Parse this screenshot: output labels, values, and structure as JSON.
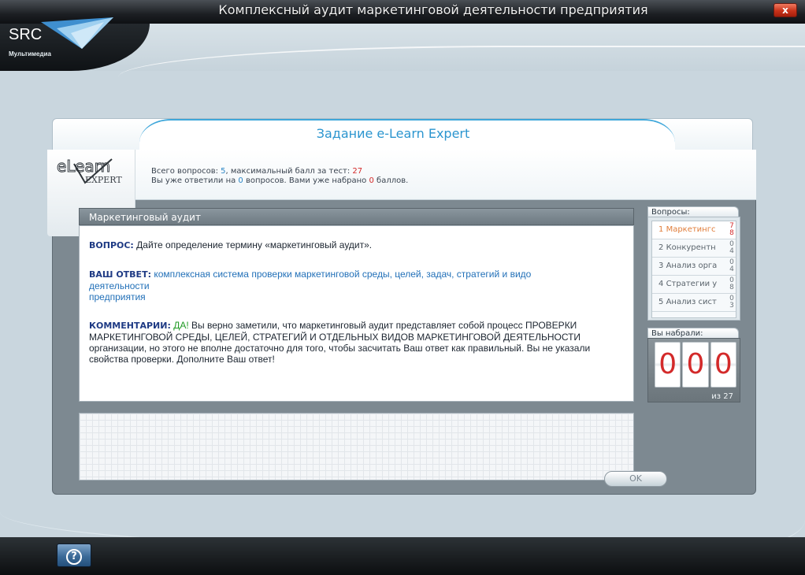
{
  "window": {
    "title": "Комплексный аудит маркетинговой деятельности предприятия",
    "close_label": "x"
  },
  "brand": {
    "name": "SRC",
    "subtitle": "Мультимедиа"
  },
  "task": {
    "title": "Задание e-Learn Expert",
    "badge_logo": "eLearn Expert"
  },
  "stats": {
    "line1_prefix": "Всего вопросов: ",
    "total_questions": "5",
    "line1_mid": ", максимальный балл за тест: ",
    "max_score": "27",
    "line2_prefix": "Вы уже ответили на ",
    "answered": "0",
    "line2_mid": " вопросов. Вами уже набрано ",
    "earned": "0",
    "line2_suffix": " баллов."
  },
  "section": {
    "title": "Маркетинговый аудит"
  },
  "question": {
    "label": "ВОПРОС:",
    "text": " Дайте определение термину «маркетинговый аудит»."
  },
  "answer": {
    "label": "ВАШ ОТВЕТ:",
    "text_line1": " комплексная система проверки маркетинговой среды, целей, задач, стратегий и видо",
    "text_line2": "деятельности",
    "text_line3": " предприятия"
  },
  "comment": {
    "label": "КОММЕНТАРИИ:",
    "yes": " ДА!",
    "text": " Вы верно заметили, что маркетинговый аудит представляет собой процесс ПРОВЕРКИ МАРКЕТИНГОВОЙ СРЕДЫ, ЦЕЛЕЙ, СТРАТЕГИЙ И ОТДЕЛЬНЫХ ВИДОВ МАРКЕТИНГОВОЙ ДЕЯТЕЛЬНОСТИ организации, но этого не вполне достаточно для того, чтобы засчитать Ваш ответ как правильный. Вы не указали свойства проверки. Дополните Ваш ответ!"
  },
  "ok_button": "OK",
  "questions_panel": {
    "title": "Вопросы:",
    "items": [
      {
        "num": "1",
        "label": "Маркетингс",
        "score_top": "7",
        "score_bottom": "8",
        "active": true
      },
      {
        "num": "2",
        "label": "Конкурентн",
        "score_top": "0",
        "score_bottom": "4",
        "active": false
      },
      {
        "num": "3",
        "label": "Анализ орга",
        "score_top": "0",
        "score_bottom": "4",
        "active": false
      },
      {
        "num": "4",
        "label": "Стратегии у",
        "score_top": "0",
        "score_bottom": "8",
        "active": false
      },
      {
        "num": "5",
        "label": "Анализ сист",
        "score_top": "0",
        "score_bottom": "3",
        "active": false
      }
    ]
  },
  "score_panel": {
    "title": "Вы набрали:",
    "digits": [
      "0",
      "0",
      "0"
    ],
    "of_max": "из 27"
  },
  "help_label": "?",
  "colors": {
    "accent_blue": "#2b95cf",
    "score_red": "#d32a2a",
    "yes_green": "#1f9a23",
    "active_orange": "#e07d3a"
  }
}
